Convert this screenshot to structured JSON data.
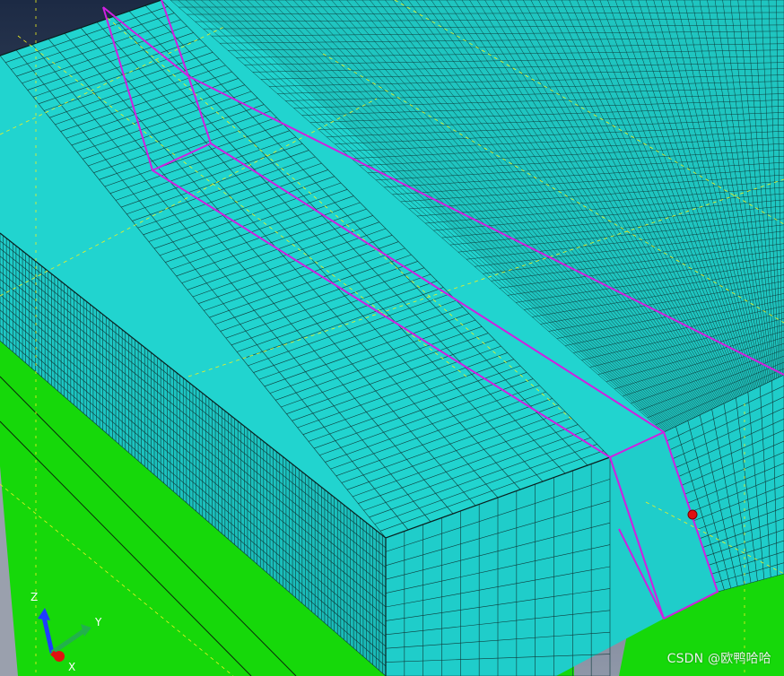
{
  "viewport": {
    "background_top": "#1c2a44",
    "background_bottom": "#8f97a8",
    "mesh_color": "#21d4cf",
    "mesh_line_color": "#0f3a3a",
    "ground_color": "#16d80a",
    "highlight_color": "#d020e0",
    "reference_line_color": "#f0f020"
  },
  "triad": {
    "z_label": "Z",
    "y_label": "Y",
    "x_label": "X",
    "z_color": "#1f3cff",
    "y_color": "#22b14c",
    "x_color": "#e01010"
  },
  "watermark": {
    "text": "CSDN @欧鸭哈哈"
  }
}
